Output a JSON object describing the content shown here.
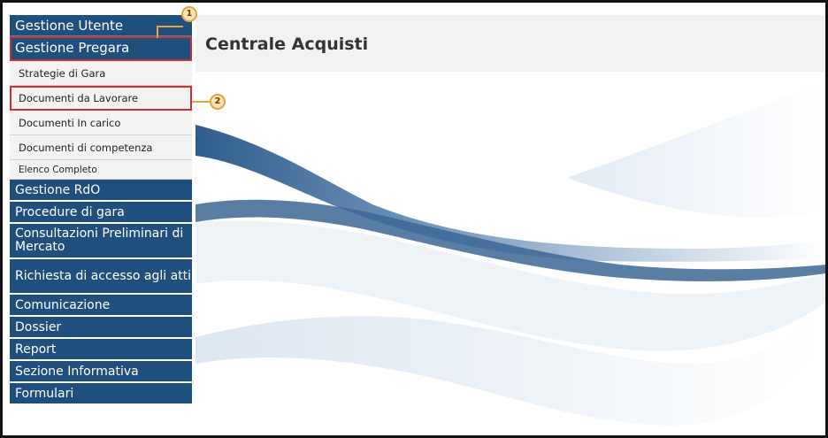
{
  "header": {
    "title": "Centrale Acquisti"
  },
  "sidebar": {
    "top_item": "Gestione Utente",
    "active_section": "Gestione Pregara",
    "sub_items": [
      {
        "label": "Strategie di Gara"
      },
      {
        "label": "Documenti da Lavorare"
      },
      {
        "label": "Documenti In carico"
      },
      {
        "label": "Documenti di competenza"
      },
      {
        "label": "Elenco Completo"
      }
    ],
    "sections": [
      {
        "label": "Gestione RdO"
      },
      {
        "label": "Procedure di gara"
      },
      {
        "label": "Consultazioni Preliminari di Mercato"
      },
      {
        "label": "Richiesta di accesso agli atti"
      },
      {
        "label": "Comunicazione"
      },
      {
        "label": "Dossier"
      },
      {
        "label": "Report"
      },
      {
        "label": "Sezione Informativa"
      },
      {
        "label": "Formulari"
      }
    ]
  },
  "callouts": [
    {
      "number": "1"
    },
    {
      "number": "2"
    }
  ],
  "colors": {
    "nav_bg": "#1f4f7c",
    "highlight": "#d32f2f",
    "callout": "#e8a33c"
  }
}
